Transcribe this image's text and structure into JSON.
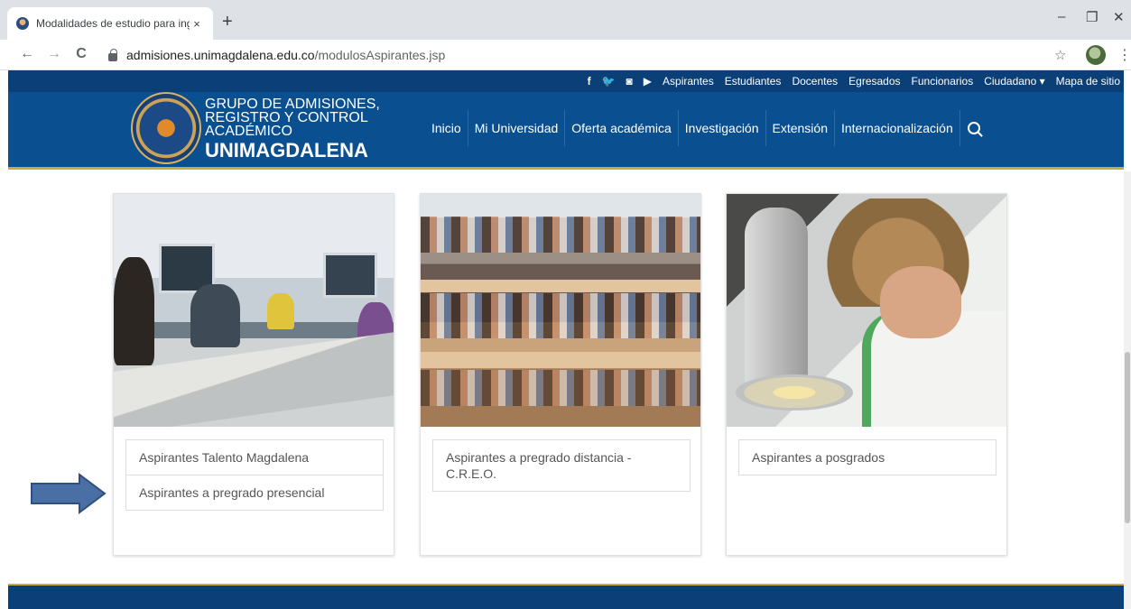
{
  "browser": {
    "tab_title": "Modalidades de estudio para ing",
    "tab_close": "×",
    "new_tab": "+",
    "url_domain": "admisiones.unimagdalena.edu.co",
    "url_path": "/modulosAspirantes.jsp",
    "back": "←",
    "forward": "→",
    "reload": "C",
    "minimize": "–",
    "restore": "❐",
    "close": "✕",
    "star": "☆",
    "menu": "⋮"
  },
  "topbar": {
    "social": [
      "f",
      "🐦",
      "◙",
      "▶"
    ],
    "links": [
      "Aspirantes",
      "Estudiantes",
      "Docentes",
      "Egresados",
      "Funcionarios",
      "Ciudadano ▾",
      "Mapa de sitio"
    ]
  },
  "logo": {
    "line1": "GRUPO DE ADMISIONES,",
    "line2": "REGISTRO Y CONTROL",
    "line3": "ACADÉMICO",
    "line4": "UNIMAGDALENA"
  },
  "mainnav": [
    "Inicio",
    "Mi Universidad",
    "Oferta académica",
    "Investigación",
    "Extensión",
    "Internacionalización"
  ],
  "cards": [
    {
      "links": [
        "Aspirantes Talento Magdalena",
        "Aspirantes a pregrado presencial"
      ]
    },
    {
      "links": [
        "Aspirantes a pregrado distancia - C.R.E.O."
      ]
    },
    {
      "links": [
        "Aspirantes a posgrados"
      ]
    }
  ],
  "colors": {
    "header_blue": "#0a4f8f",
    "accent_gold": "#c8a84a",
    "arrow_blue": "#4a6fa5"
  }
}
